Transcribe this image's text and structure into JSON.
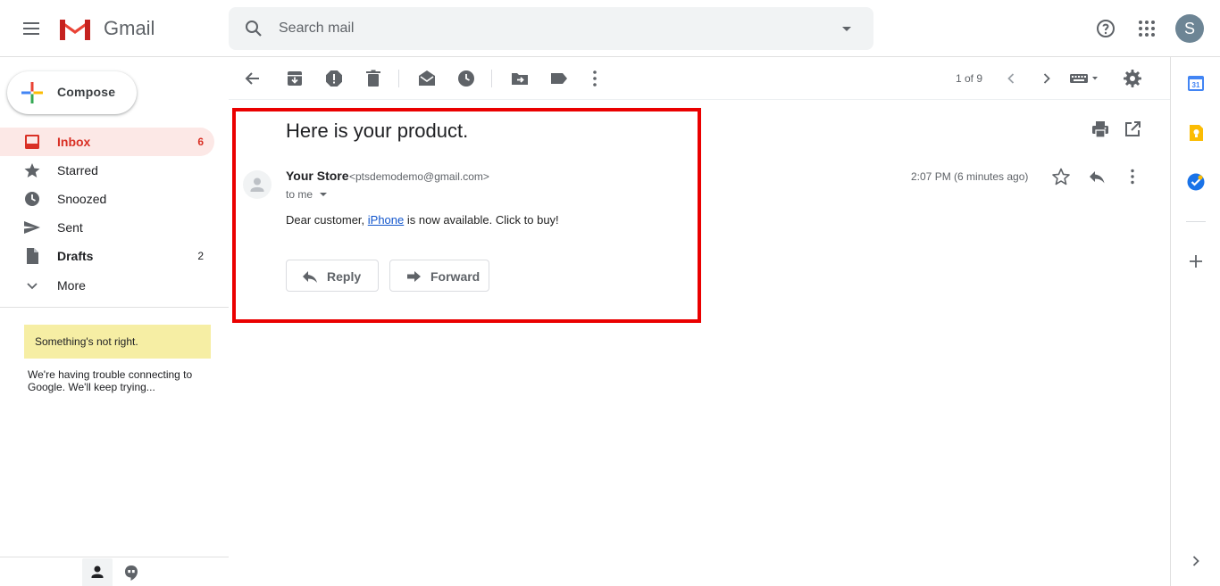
{
  "header": {
    "product_name": "Gmail",
    "search_placeholder": "Search mail",
    "avatar_initial": "S"
  },
  "nav": {
    "compose_label": "Compose",
    "items": [
      {
        "label": "Inbox",
        "count": "6",
        "icon": "inbox-icon",
        "active": true,
        "bold": true
      },
      {
        "label": "Starred",
        "count": "",
        "icon": "star-icon"
      },
      {
        "label": "Snoozed",
        "count": "",
        "icon": "clock-icon"
      },
      {
        "label": "Sent",
        "count": "",
        "icon": "send-icon"
      },
      {
        "label": "Drafts",
        "count": "2",
        "icon": "draft-icon",
        "bold": true
      },
      {
        "label": "More",
        "count": "",
        "icon": "chevron-down-icon"
      }
    ],
    "warning_title": "Something's not right.",
    "warning_text": "We're having trouble connecting to Google. We'll keep trying..."
  },
  "toolbar": {
    "page_count": "1 of 9"
  },
  "message": {
    "subject": "Here is your product.",
    "sender_name": "Your Store",
    "sender_email": "<ptsdemodemo@gmail.com>",
    "recipient": "to me",
    "timestamp": "2:07 PM (6 minutes ago)",
    "body_prefix": "Dear customer, ",
    "body_link": "iPhone",
    "body_suffix": " is now available. Click to buy!",
    "reply_label": "Reply",
    "forward_label": "Forward"
  },
  "colors": {
    "accent_red": "#d93025",
    "highlight_border": "#ea0000",
    "link_blue": "#1155cc",
    "warning_bg": "#f6eea4"
  }
}
